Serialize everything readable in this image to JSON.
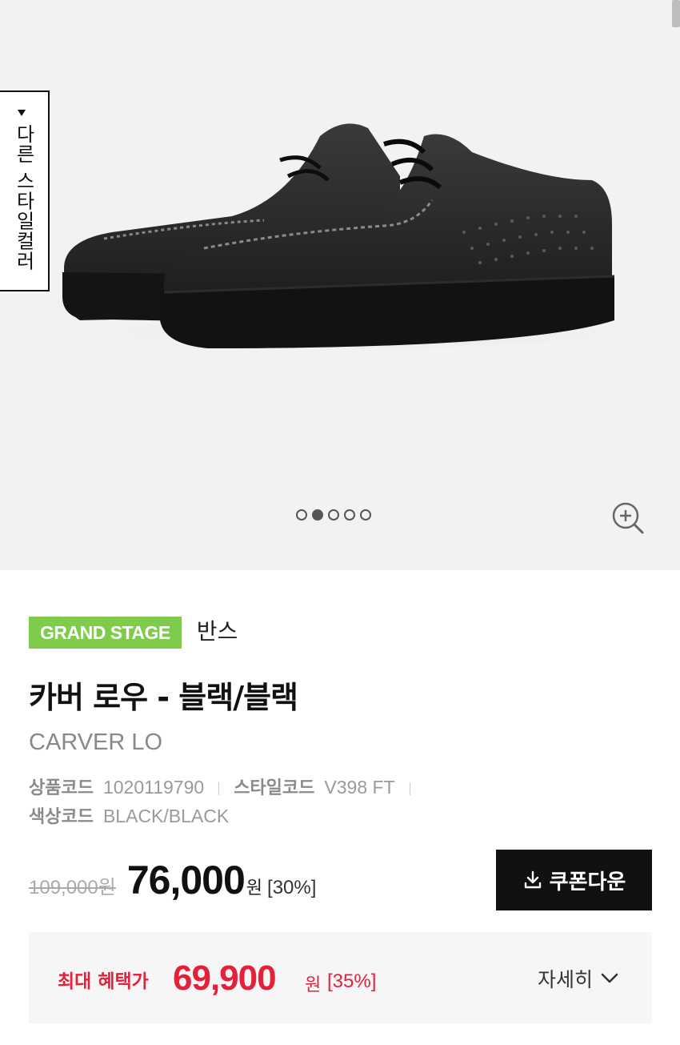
{
  "gallery": {
    "style_gallery_label": "다른 스타일컬러",
    "image_count": 5,
    "active_image_index": 1
  },
  "product": {
    "badge": "GRAND STAGE",
    "brand": "반스",
    "title": "카버 로우 - 블랙/블랙",
    "english_name": "CARVER LO",
    "product_code_label": "상품코드",
    "product_code": "1020119790",
    "style_code_label": "스타일코드",
    "style_code": "V398 FT",
    "color_code_label": "색상코드",
    "color_code": "BLACK/BLACK"
  },
  "price": {
    "original": "109,000원",
    "sale": "76,000",
    "currency": "원",
    "discount": "[30%]",
    "coupon_button": "쿠폰다운"
  },
  "benefit": {
    "label": "최대 혜택가",
    "price": "69,900",
    "currency": "원",
    "discount": "[35%]",
    "detail": "자세히"
  },
  "colors": {
    "badge": "#7fcc4d",
    "benefit_red": "#e4203a",
    "gallery_bg": "#f2f2f2"
  }
}
